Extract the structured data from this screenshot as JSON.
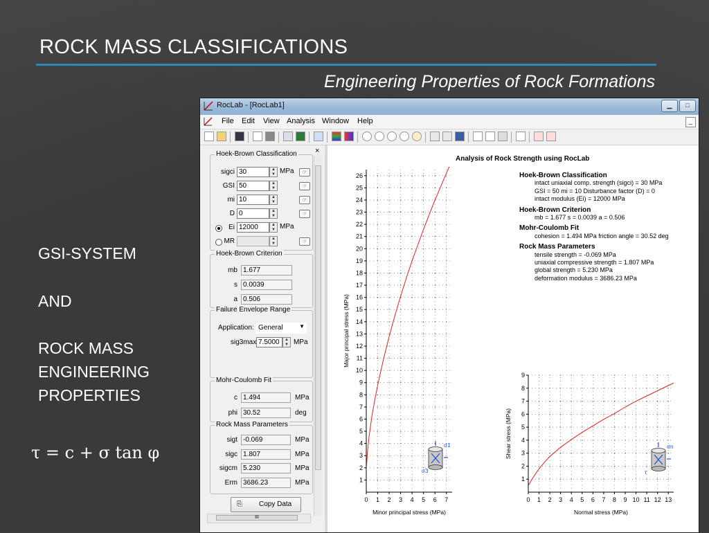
{
  "slide": {
    "title": "ROCK MASS CLASSIFICATIONS",
    "subtitle": "Engineering Properties of Rock Formations",
    "side_lines": [
      "GSI-SYSTEM",
      "AND",
      "ROCK MASS",
      "ENGINEERING",
      "PROPERTIES"
    ],
    "formula": "τ  =  c  +  σ  tan φ"
  },
  "window": {
    "title": "RocLab - [RocLab1]",
    "menu": [
      "File",
      "Edit",
      "View",
      "Analysis",
      "Window",
      "Help"
    ],
    "mdi_min": "_"
  },
  "panel": {
    "close": "×",
    "hoek_brown_classification": {
      "label": "Hoek-Brown Classification",
      "fields": [
        {
          "name": "sigci",
          "value": "30",
          "unit": "MPa"
        },
        {
          "name": "GSI",
          "value": "50",
          "unit": ""
        },
        {
          "name": "mi",
          "value": "10",
          "unit": ""
        },
        {
          "name": "D",
          "value": "0",
          "unit": ""
        },
        {
          "name": "Ei",
          "value": "12000",
          "unit": "MPa",
          "radio": true,
          "selected": true
        },
        {
          "name": "MR",
          "value": "",
          "unit": "",
          "radio": true,
          "selected": false
        }
      ]
    },
    "hoek_brown_criterion": {
      "label": "Hoek-Brown Criterion",
      "fields": [
        {
          "name": "mb",
          "value": "1.677"
        },
        {
          "name": "s",
          "value": "0.0039"
        },
        {
          "name": "a",
          "value": "0.506"
        }
      ]
    },
    "failure_envelope": {
      "label": "Failure Envelope Range",
      "application_label": "Application:",
      "application_value": "General",
      "sig3max_label": "sig3max",
      "sig3max_value": "7.5000",
      "sig3max_unit": "MPa"
    },
    "mohr_coulomb": {
      "label": "Mohr-Coulomb Fit",
      "fields": [
        {
          "name": "c",
          "value": "1.494",
          "unit": "MPa"
        },
        {
          "name": "phi",
          "value": "30.52",
          "unit": "deg"
        }
      ]
    },
    "rock_mass_parameters": {
      "label": "Rock Mass Parameters",
      "fields": [
        {
          "name": "sigt",
          "value": "-0.069",
          "unit": "MPa"
        },
        {
          "name": "sigc",
          "value": "1.807",
          "unit": "MPa"
        },
        {
          "name": "sigcm",
          "value": "5.230",
          "unit": "MPa"
        },
        {
          "name": "Erm",
          "value": "3686.23",
          "unit": "MPa"
        }
      ]
    },
    "copy_button": "Copy Data",
    "hscroll_label": "III"
  },
  "document": {
    "title": "Analysis of Rock Strength using RocLab",
    "summary": [
      {
        "heading": "Hoek-Brown Classification",
        "lines": [
          "intact uniaxial comp. strength (sigci) = 30 MPa",
          "GSI = 50    mi = 10    Disturbance factor (D) = 0",
          "intact modulus (Ei) = 12000 MPa"
        ]
      },
      {
        "heading": "Hoek-Brown Criterion",
        "lines": [
          "mb = 1.677    s = 0.0039    a = 0.506"
        ]
      },
      {
        "heading": "Mohr-Coulomb Fit",
        "lines": [
          "cohesion = 1.494 MPa    friction angle = 30.52 deg"
        ]
      },
      {
        "heading": "Rock Mass Parameters",
        "lines": [
          "tensile strength = -0.069 MPa",
          "uniaxial compressive strength = 1.807 MPa",
          "global strength = 5.230 MPa",
          "deformation modulus = 3686.23 MPa"
        ]
      }
    ]
  },
  "chart_data": [
    {
      "type": "line",
      "xlabel": "Minor principal stress (MPa)",
      "ylabel": "Major principal stress (MPa)",
      "xlim": [
        0,
        7.5
      ],
      "ylim": [
        0,
        26.5
      ],
      "xticks": [
        0,
        1,
        2,
        3,
        4,
        5,
        6,
        7
      ],
      "yticks": [
        1,
        2,
        3,
        4,
        5,
        6,
        7,
        8,
        9,
        10,
        11,
        12,
        13,
        14,
        15,
        16,
        17,
        18,
        19,
        20,
        21,
        22,
        23,
        24,
        25,
        26
      ],
      "grid": true,
      "color": "#e0201f",
      "inset_labels": [
        "σ1",
        "σ3"
      ],
      "series": [
        {
          "x": [
            0,
            0.1,
            0.25,
            0.5,
            0.75,
            1,
            1.5,
            2,
            2.5,
            3,
            3.5,
            4,
            4.5,
            5,
            5.5,
            6,
            6.5,
            7,
            7.5
          ],
          "y": [
            1.8,
            3.3,
            4.6,
            6.3,
            7.6,
            8.8,
            10.9,
            12.8,
            14.5,
            16.1,
            17.6,
            19.0,
            20.3,
            21.6,
            22.8,
            24.0,
            25.1,
            26.2,
            27.3
          ]
        }
      ]
    },
    {
      "type": "line",
      "xlabel": "Normal stress (MPa)",
      "ylabel": "Shear stress (MPa)",
      "xlim": [
        0,
        13.5
      ],
      "ylim": [
        0,
        9
      ],
      "xticks": [
        0,
        1,
        2,
        3,
        4,
        5,
        6,
        7,
        8,
        9,
        10,
        11,
        12,
        13
      ],
      "yticks": [
        1,
        2,
        3,
        4,
        5,
        6,
        7,
        8,
        9
      ],
      "grid": true,
      "color": "#e0201f",
      "inset_labels": [
        "σn",
        "τ"
      ],
      "series": [
        {
          "x": [
            0,
            0.3,
            0.7,
            1,
            1.5,
            2,
            3,
            4,
            5,
            6,
            7,
            8,
            9,
            10,
            11,
            12,
            13,
            13.5
          ],
          "y": [
            0.5,
            0.95,
            1.45,
            1.8,
            2.3,
            2.75,
            3.45,
            4.05,
            4.6,
            5.1,
            5.6,
            6.05,
            6.55,
            7.0,
            7.4,
            7.8,
            8.2,
            8.4
          ]
        }
      ]
    }
  ]
}
